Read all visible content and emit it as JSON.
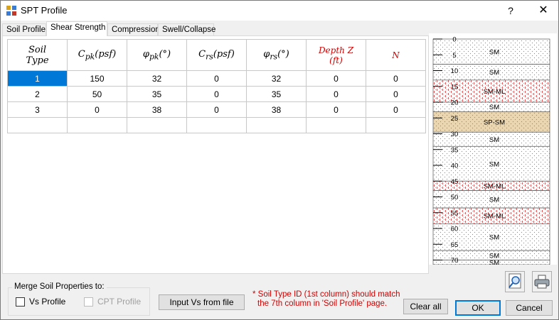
{
  "window": {
    "title": "SPT Profile",
    "help_label": "?",
    "close_label": "✕"
  },
  "tabs": [
    {
      "label": "Soil Profile",
      "active": false
    },
    {
      "label": "Shear Strength",
      "active": true
    },
    {
      "label": "Compression",
      "active": false
    },
    {
      "label": "Swell/Collapse",
      "active": false
    }
  ],
  "table": {
    "headers": [
      {
        "main": "Soil",
        "line2": "Type",
        "sub": ""
      },
      {
        "main": "C",
        "sub": "pk",
        "unit": "(psf)"
      },
      {
        "main": "φ",
        "sub": "pk",
        "unit": "(°)"
      },
      {
        "main": "C",
        "sub": "rs",
        "unit": "(psf)"
      },
      {
        "main": "φ",
        "sub": "rs",
        "unit": "(°)"
      },
      {
        "main": "Depth Z",
        "line2": "(ft)",
        "sub": ""
      },
      {
        "main": "N",
        "sub": ""
      }
    ],
    "rows": [
      [
        "1",
        "150",
        "32",
        "0",
        "32",
        "0",
        "0"
      ],
      [
        "2",
        "50",
        "35",
        "0",
        "35",
        "0",
        "0"
      ],
      [
        "3",
        "0",
        "38",
        "0",
        "38",
        "0",
        "0"
      ],
      [
        "",
        "",
        "",
        "",
        "",
        "",
        ""
      ]
    ],
    "selected_cell": "row 1, column 1"
  },
  "profile": {
    "depth_ticks": [
      "0",
      "5",
      "10",
      "15",
      "20",
      "25",
      "30",
      "35",
      "40",
      "45",
      "50",
      "55",
      "60",
      "65",
      "70"
    ],
    "layers": [
      {
        "label": "SM",
        "top_ft": 0,
        "bottom_ft": 8,
        "pattern": "sm"
      },
      {
        "label": "SM",
        "top_ft": 8,
        "bottom_ft": 13,
        "pattern": "sm"
      },
      {
        "label": "SM-ML",
        "top_ft": 13,
        "bottom_ft": 20,
        "pattern": "smml"
      },
      {
        "label": "SM",
        "top_ft": 20,
        "bottom_ft": 23,
        "pattern": "sm"
      },
      {
        "label": "SP-SM",
        "top_ft": 23,
        "bottom_ft": 29.5,
        "pattern": "spsm"
      },
      {
        "label": "SM",
        "top_ft": 29.5,
        "bottom_ft": 34,
        "pattern": "sm"
      },
      {
        "label": "SM",
        "top_ft": 34,
        "bottom_ft": 45,
        "pattern": "sm"
      },
      {
        "label": "SM-ML",
        "top_ft": 45,
        "bottom_ft": 48,
        "pattern": "smml"
      },
      {
        "label": "SM",
        "top_ft": 48,
        "bottom_ft": 53.5,
        "pattern": "sm"
      },
      {
        "label": "SM-ML",
        "top_ft": 53.5,
        "bottom_ft": 58.5,
        "pattern": "smml"
      },
      {
        "label": "SM",
        "top_ft": 58.5,
        "bottom_ft": 67,
        "pattern": "sm"
      },
      {
        "label": "SM",
        "top_ft": 67,
        "bottom_ft": 70,
        "pattern": "sm"
      },
      {
        "label": "SM",
        "top_ft": 70,
        "bottom_ft": 72,
        "pattern": "sm"
      }
    ]
  },
  "merge": {
    "legend": "Merge Soil Properties to:",
    "vs_profile_label": "Vs Profile",
    "vs_profile_checked": false,
    "cpt_profile_label": "CPT Profile",
    "cpt_profile_enabled": false
  },
  "buttons": {
    "input_vs": "Input Vs from file",
    "clear_all": "Clear all",
    "ok": "OK",
    "cancel": "Cancel"
  },
  "note": {
    "line1": "* Soil Type ID (1st column) should match",
    "line2": "the 7th column in 'Soil Profile' page."
  },
  "colors": {
    "selection": "#0078d7",
    "note_red": "#d00000",
    "smml_stripe": "#e05050",
    "spsm_fill": "#ead7b2"
  }
}
